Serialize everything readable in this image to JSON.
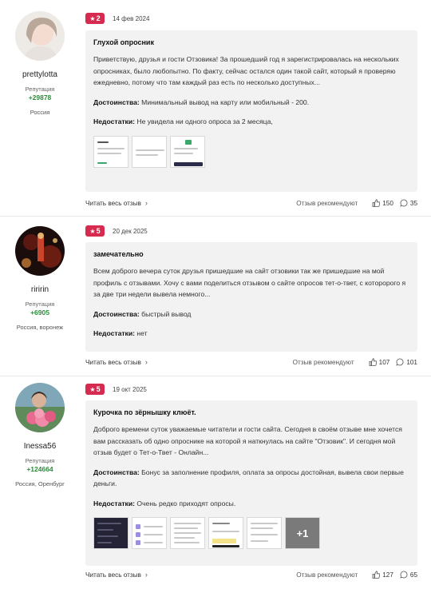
{
  "reviews": [
    {
      "author": "prettylotta",
      "rep_label": "Репутация",
      "rep_value": "+29878",
      "location": "Россия",
      "rating": "2",
      "date": "14 фев 2024",
      "title": "Глухой опросник",
      "text": "Приветствую, друзья и гости Отзовика! За прошедший год я зарегистрировалась на нескольких опросниках, было любопытно. По факту, сейчас остался один такой сайт, который я проверяю ежедневно, потому что там каждый раз есть по несколько доступных...",
      "pros_label": "Достоинства:",
      "pros": "Минимальный вывод на карту или мобильный - 200.",
      "cons_label": "Недостатки:",
      "cons": "Не увидела ни одного опроса за 2 месяца,",
      "read_more": "Читать весь отзыв",
      "recommends": "Отзыв рекомендуют",
      "likes": "150",
      "comments": "35"
    },
    {
      "author": "riririn",
      "rep_label": "Репутация",
      "rep_value": "+6905",
      "location": "Россия, воронеж",
      "rating": "5",
      "date": "20 дек 2025",
      "title": "замечательно",
      "text": "Всем доброго вечера суток друзья пришедшие на сайт отзовики так же пришедшие на мой профиль с отзывами. Хочу с вами поделиться отзывом о сайте опросов тет-о-твет, с которорого я за две три недели вывела немного...",
      "pros_label": "Достоинства:",
      "pros": "быстрый вывод",
      "cons_label": "Недостатки:",
      "cons": "нет",
      "read_more": "Читать весь отзыв",
      "recommends": "Отзыв рекомендуют",
      "likes": "107",
      "comments": "101"
    },
    {
      "author": "Inessa56",
      "rep_label": "Репутация",
      "rep_value": "+124664",
      "location": "Россия, Оренбург",
      "rating": "5",
      "date": "19 окт 2025",
      "title": "Курочка по зёрнышку клюёт.",
      "text": "Доброго времени суток уважаемые читатели и гости сайта. Сегодня в своём отзыве мне хочется вам рассказать об одно опроснике на которой я наткнулась на сайте \"Отзовик\". И сегодня мой отзыв будет о Тет-о-Твет - Онлайн...",
      "pros_label": "Достоинства:",
      "pros": "Бонус за заполнение профиля, оплата за опросы достойная, вывела свои первые деньги.",
      "cons_label": "Недостатки:",
      "cons": "Очень редко приходят опросы.",
      "more_photos": "+1",
      "read_more": "Читать весь отзыв",
      "recommends": "Отзыв рекомендуют",
      "likes": "127",
      "comments": "65"
    }
  ],
  "colors": {
    "badge": "#d62b4f",
    "reputation": "#2e8b3d",
    "card_bg": "#f2f2f2"
  },
  "icons": [
    "star-icon",
    "chevron-right-icon",
    "thumbs-up-icon",
    "comment-icon"
  ]
}
